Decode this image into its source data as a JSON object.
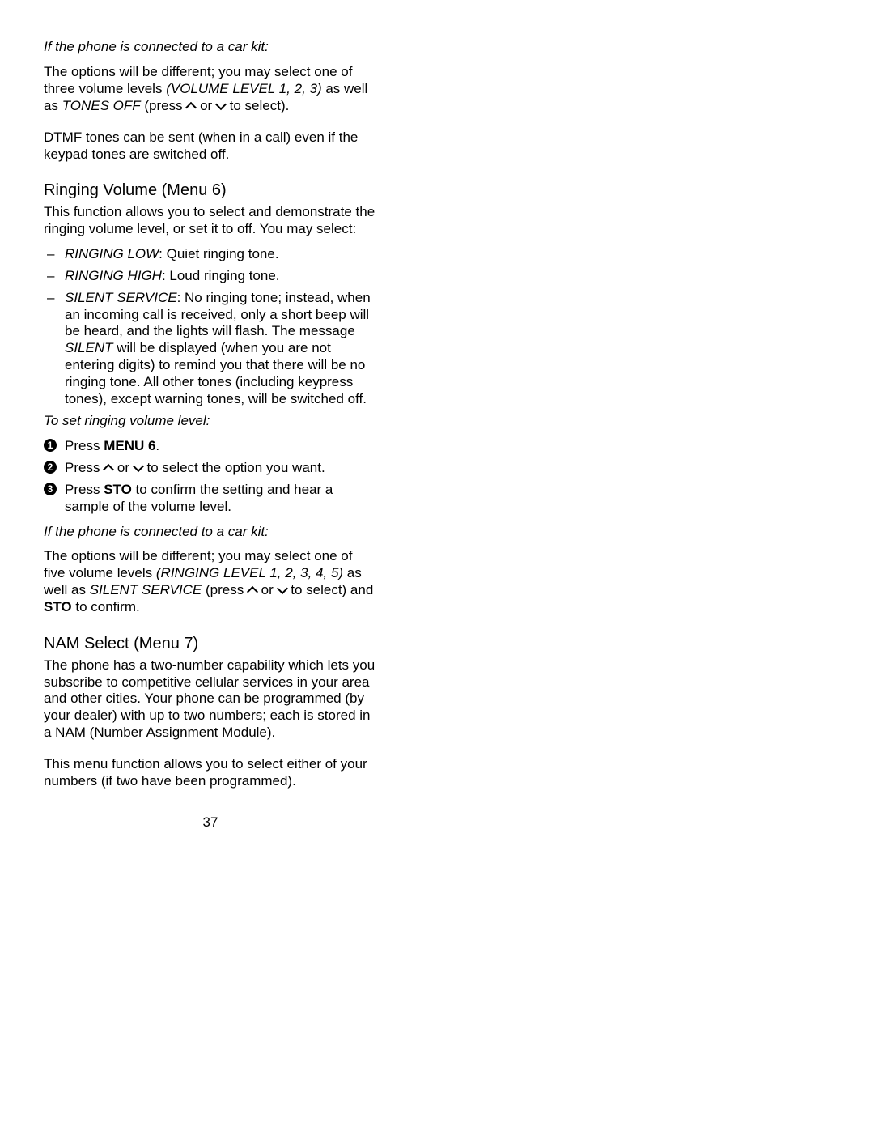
{
  "page_number": "37",
  "blocks": {
    "car_kit_note_1": "If the phone is connected to a car kit:",
    "car_kit_body_1a": "The options will be different; you may select one of three volume levels ",
    "car_kit_body_1b": "(VOLUME LEVEL 1, 2, 3)",
    "car_kit_body_1c": " as well as ",
    "car_kit_body_1d": "TONES OFF",
    "car_kit_body_1e": " (press ",
    "car_kit_body_1f": " or ",
    "car_kit_body_1g": " to select).",
    "dtmf_note": "DTMF tones can be sent (when in a call) even if the keypad tones are switched off.",
    "ringing_heading": "Ringing Volume (Menu 6)",
    "ringing_intro": "This function allows you to select and demonstrate the ringing volume level, or set it to off. You may select:",
    "ringing_low_label": "RINGING LOW",
    "ringing_low_text": ": Quiet ringing tone.",
    "ringing_high_label": "RINGING HIGH",
    "ringing_high_text": ": Loud ringing tone.",
    "silent_label": "SILENT SERVICE",
    "silent_text_a": ": No ringing tone; instead, when an incoming call is received, only a short beep will be heard, and the lights will flash. The message ",
    "silent_text_b": "SILENT",
    "silent_text_c": " will be displayed (when you are not entering digits) to remind you that there will be no ringing tone. All other tones (including keypress tones), except warning tones, will be switched off.",
    "to_set_ringing": "To set ringing volume level:",
    "step1_a": "Press ",
    "step1_b": "MENU 6",
    "step1_c": ".",
    "step2_a": "Press ",
    "step2_b": " or ",
    "step2_c": " to select the option you want.",
    "step3_a": "Press ",
    "step3_b": "STO",
    "step3_c": " to confirm the setting and hear a sample of the volume level.",
    "car_kit_note_2": "If the phone is connected to a car kit:",
    "car_kit_body_2a": "The options will be different; you may select one of five volume levels ",
    "car_kit_body_2b": "(RINGING LEVEL 1, 2, 3, 4, 5)",
    "car_kit_body_2c": " as well as ",
    "car_kit_body_2d": "SILENT SERVICE",
    "car_kit_body_2e": " (press ",
    "car_kit_body_2f": " or ",
    "car_kit_body_2g": " to select) and ",
    "car_kit_body_2h": "STO",
    "car_kit_body_2i": " to confirm.",
    "nam_heading": "NAM Select (Menu 7)",
    "nam_body_1": "The phone has a two-number capability which lets you subscribe to competitive cellular services in your area and other cities. Your phone can be programmed (by your dealer) with up to two numbers; each is stored in a NAM (Number Assignment Module).",
    "nam_body_2": "This menu function allows you to select either of your numbers (if two have been programmed)."
  }
}
